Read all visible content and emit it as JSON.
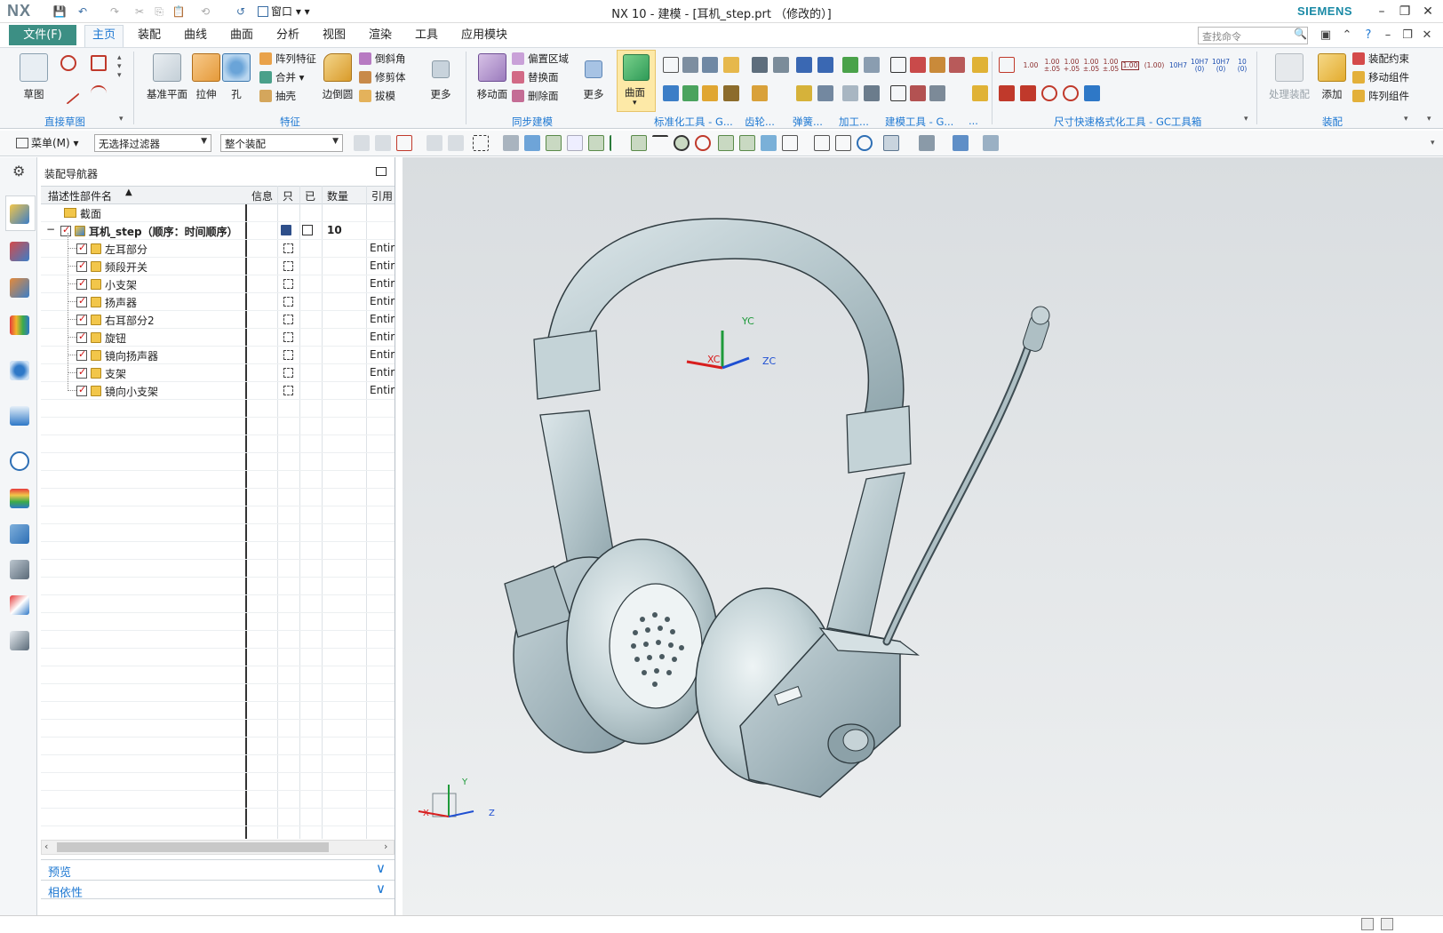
{
  "app": {
    "logo": "NX",
    "window_title": "NX 10 - 建模 - [耳机_step.prt （修改的）]",
    "vendor": "SIEMENS",
    "window_menu": "窗口"
  },
  "tabs": {
    "file": "文件(F)",
    "items": [
      "主页",
      "装配",
      "曲线",
      "曲面",
      "分析",
      "视图",
      "渲染",
      "工具",
      "应用模块"
    ],
    "active": "主页",
    "search_placeholder": "查找命令"
  },
  "ribbon": {
    "direct_sketch": {
      "sketch": "草图",
      "group": "直接草图"
    },
    "feature": {
      "datum_plane": "基准平面",
      "extrude": "拉伸",
      "hole": "孔",
      "pattern": "阵列特征",
      "unite": "合并",
      "shell": "抽壳",
      "edge_blend": "边倒圆",
      "chamfer": "倒斜角",
      "trim_body": "修剪体",
      "draft": "拔模",
      "more": "更多",
      "group": "特征"
    },
    "sync": {
      "move_face": "移动面",
      "offset_region": "偏置区域",
      "replace_face": "替换面",
      "delete_face": "删除面",
      "more": "更多",
      "group": "同步建模"
    },
    "surface": {
      "label": "曲面"
    },
    "groups_misc": [
      "标准化工具 - G...",
      "齿轮...",
      "弹簧...",
      "加工...",
      "建模工具 - G...",
      "..."
    ],
    "dim_group": "尺寸快速格式化工具 - GC工具箱",
    "dim_values": [
      "1.00",
      "1.00\n±.05",
      "1.00\n+.05",
      "1.00\n±.05",
      "1.00\n±.05",
      "1.00",
      "(1.00)",
      "10H7",
      "10H7\n(0)",
      "10H7\n(0)",
      "10\n(0)"
    ],
    "assembly": {
      "process": "处理装配",
      "add": "添加",
      "constraint": "装配约束",
      "move_comp": "移动组件",
      "pattern_comp": "阵列组件",
      "group": "装配"
    }
  },
  "toolbar2": {
    "menu": "菜单(M)",
    "filter": "无选择过滤器",
    "scope": "整个装配"
  },
  "navigator": {
    "title": "装配导航器",
    "columns": [
      "描述性部件名",
      "信息",
      "只",
      "已",
      "数量",
      "引用"
    ],
    "section_row": "截面",
    "root": {
      "name": "耳机_step（顺序：时间顺序）",
      "qty": "10"
    },
    "parts": [
      {
        "name": "左耳部分",
        "ref": "Entir"
      },
      {
        "name": "频段开关",
        "ref": "Entir"
      },
      {
        "name": "小支架",
        "ref": "Entir"
      },
      {
        "name": "扬声器",
        "ref": "Entir"
      },
      {
        "name": "右耳部分2",
        "ref": "Entir"
      },
      {
        "name": "旋钮",
        "ref": "Entir"
      },
      {
        "name": "镜向扬声器",
        "ref": "Entir"
      },
      {
        "name": "支架",
        "ref": "Entir"
      },
      {
        "name": "镜向小支架",
        "ref": "Entir"
      }
    ],
    "preview": "预览",
    "dependency": "相依性"
  },
  "viewport": {
    "csys_center": {
      "xc": "XC",
      "yc": "YC",
      "zc": "ZC"
    },
    "triad": {
      "x": "X",
      "y": "Y",
      "z": "Z"
    },
    "model_color": "#b9c9cf"
  },
  "colors": {
    "accent": "#1e78d2",
    "file_tab": "#3c8f84",
    "vendor": "#1a8aa6"
  }
}
